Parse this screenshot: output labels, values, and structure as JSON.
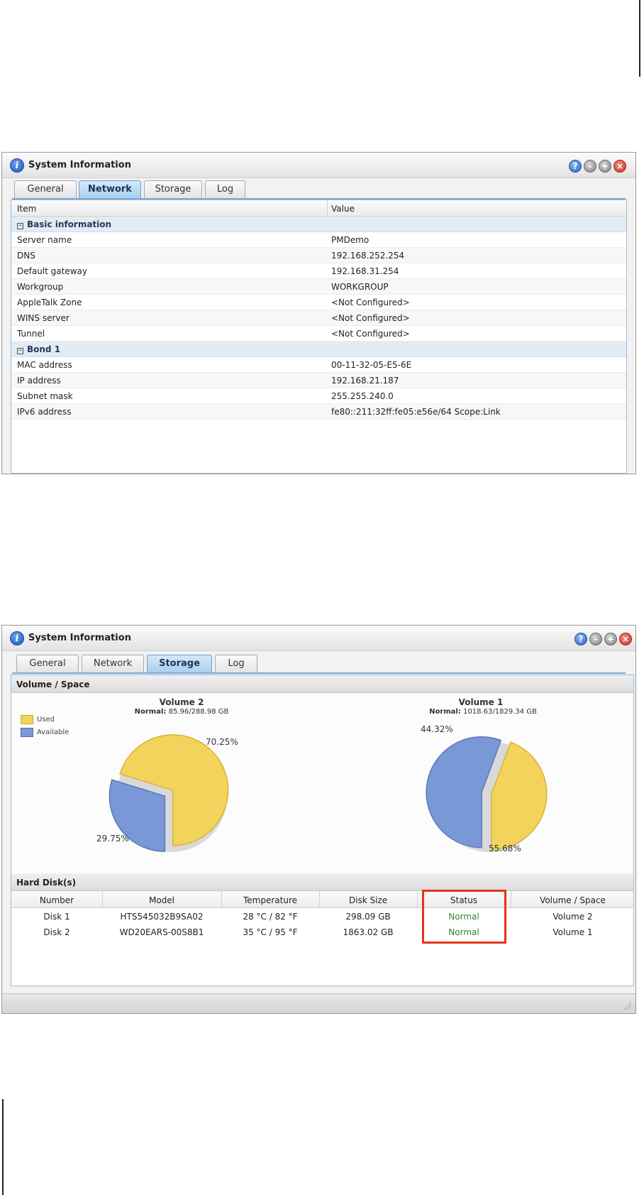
{
  "window_title": "System Information",
  "tabs": [
    "General",
    "Network",
    "Storage",
    "Log"
  ],
  "network": {
    "columns": [
      "Item",
      "Value"
    ],
    "groups": [
      {
        "name": "Basic information",
        "rows": [
          [
            "Server name",
            "PMDemo"
          ],
          [
            "DNS",
            "192.168.252.254"
          ],
          [
            "Default gateway",
            "192.168.31.254"
          ],
          [
            "Workgroup",
            "WORKGROUP"
          ],
          [
            "AppleTalk Zone",
            "<Not Configured>"
          ],
          [
            "WINS server",
            "<Not Configured>"
          ],
          [
            "Tunnel",
            "<Not Configured>"
          ]
        ]
      },
      {
        "name": "Bond 1",
        "rows": [
          [
            "MAC address",
            "00-11-32-05-E5-6E"
          ],
          [
            "IP address",
            "192.168.21.187"
          ],
          [
            "Subnet mask",
            "255.255.240.0"
          ],
          [
            "IPv6 address",
            "fe80::211:32ff:fe05:e56e/64 Scope:Link"
          ]
        ]
      }
    ]
  },
  "storage": {
    "volume_section": "Volume / Space",
    "legend": [
      "Used",
      "Available"
    ],
    "status_prefix": "Normal:",
    "volumes": [
      {
        "name": "Volume 2",
        "usage": "85.96/288.98 GB",
        "used_pct": 29.75,
        "avail_pct": 70.25,
        "used_label": "29.75%",
        "avail_label": "70.25%"
      },
      {
        "name": "Volume 1",
        "usage": "1018.63/1829.34 GB",
        "used_pct": 55.68,
        "avail_pct": 44.32,
        "used_label": "55.68%",
        "avail_label": "44.32%"
      }
    ],
    "hd_section": "Hard Disk(s)",
    "hd_columns": [
      "Number",
      "Model",
      "Temperature",
      "Disk Size",
      "Status",
      "Volume / Space"
    ],
    "disks": [
      [
        "Disk 1",
        "HTS545032B9SA02",
        "28 °C / 82 °F",
        "298.09 GB",
        "Normal",
        "Volume 2"
      ],
      [
        "Disk 2",
        "WD20EARS-00S8B1",
        "35 °C / 95 °F",
        "1863.02 GB",
        "Normal",
        "Volume 1"
      ]
    ]
  },
  "colors": {
    "used": "#7b98d6",
    "available": "#f3d35c",
    "highlight": "#e6331c",
    "status_ok": "#2b8a2b"
  },
  "chart_data": [
    {
      "type": "pie",
      "title": "Volume 2",
      "categories": [
        "Used",
        "Available"
      ],
      "values": [
        29.75,
        70.25
      ]
    },
    {
      "type": "pie",
      "title": "Volume 1",
      "categories": [
        "Used",
        "Available"
      ],
      "values": [
        55.68,
        44.32
      ]
    }
  ]
}
